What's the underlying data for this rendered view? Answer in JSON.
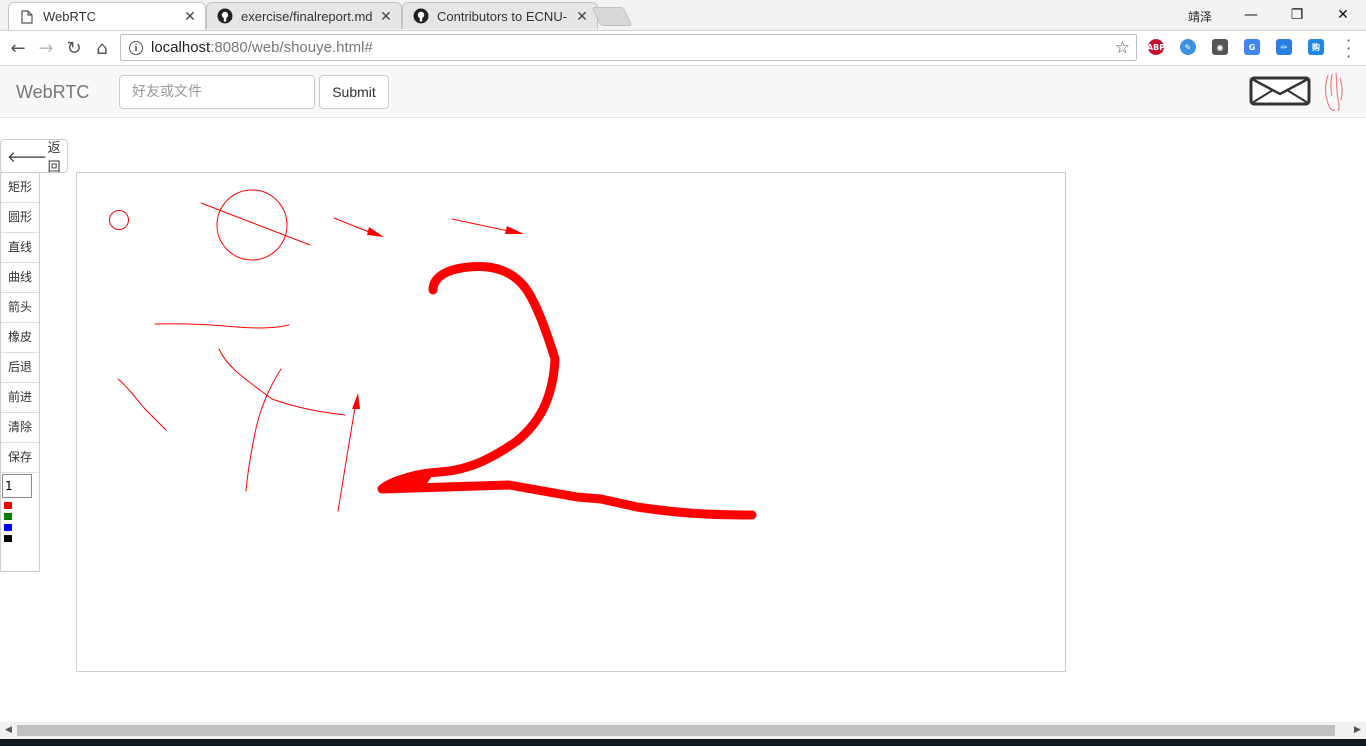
{
  "browser": {
    "tabs": [
      {
        "title": "WebRTC",
        "active": true,
        "icon": "page-icon"
      },
      {
        "title": "exercise/finalreport.md",
        "active": false,
        "icon": "github-icon"
      },
      {
        "title": "Contributors to ECNU-",
        "active": false,
        "icon": "github-icon"
      }
    ],
    "profile_name": "靖泽",
    "url_host": "localhost",
    "url_rest": ":8080/web/shouye.html#",
    "extensions": [
      {
        "name": "abp-icon",
        "label": "ABP",
        "color": "#c8102e"
      },
      {
        "name": "feather-icon",
        "label": "✎",
        "color": "#3d8fe0"
      },
      {
        "name": "eye-icon",
        "label": "◉",
        "color": "#555555"
      },
      {
        "name": "translate-icon",
        "label": "G",
        "color": "#4285f4"
      },
      {
        "name": "pen-icon",
        "label": "✏",
        "color": "#2a7de1"
      },
      {
        "name": "shop-icon",
        "label": "购",
        "color": "#1e88e5"
      }
    ]
  },
  "app": {
    "brand": "WebRTC",
    "search_placeholder": "好友或文件",
    "submit_label": "Submit",
    "back_label": "返回",
    "tools": [
      "矩形",
      "圆形",
      "直线",
      "曲线",
      "箭头",
      "橡皮",
      "后退",
      "前进",
      "清除",
      "保存"
    ],
    "line_width": "1",
    "colors": [
      {
        "name": "red",
        "hex": "#ff0000"
      },
      {
        "name": "green",
        "hex": "#008000"
      },
      {
        "name": "blue",
        "hex": "#0000ff"
      },
      {
        "name": "black",
        "hex": "#000000"
      }
    ],
    "stroke_color": "#ff0000"
  }
}
